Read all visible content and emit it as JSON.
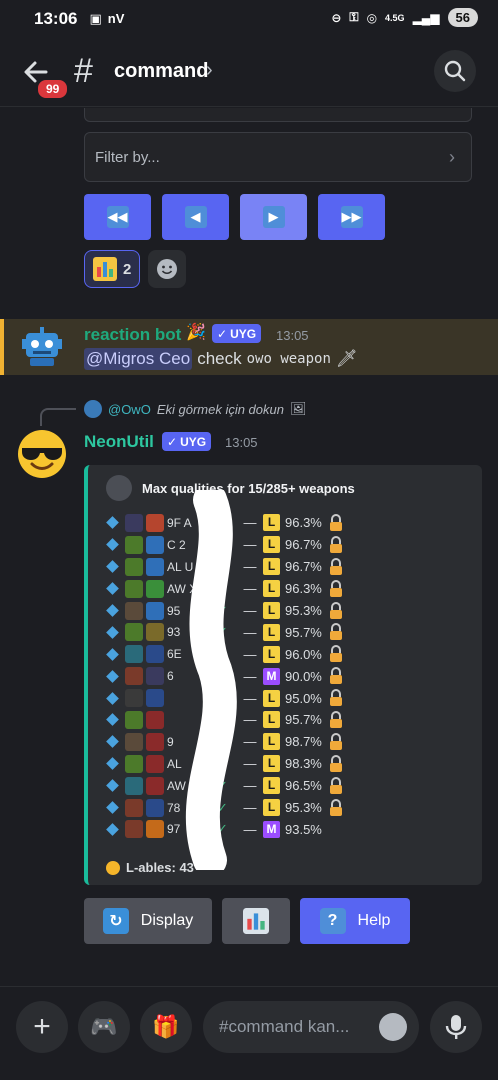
{
  "status": {
    "time": "13:06",
    "left_icons": "nV",
    "network": "4.5G",
    "battery": "56"
  },
  "header": {
    "back_badge": "99",
    "channel": "command"
  },
  "filter": {
    "placeholder": "Filter by..."
  },
  "reactions": {
    "count": "2"
  },
  "message1": {
    "author": "reaction bot",
    "tag": "UYG",
    "time": "13:05",
    "mention": "@Migros Ceo",
    "text": "check",
    "code": "owo weapon"
  },
  "reply": {
    "user": "@OwO",
    "hint": "Eki görmek için dokun"
  },
  "message2": {
    "author": "NeonUtil",
    "tag": "UYG",
    "time": "13:05",
    "embed_title": "Max qualities for 15/285+ weapons",
    "footer": "L-ables: 43",
    "weapons": [
      {
        "name": "9F  A",
        "q": "L",
        "pct": "96.3%",
        "lock": true,
        "c1": "#3a3a5e",
        "c2": "#b5452e"
      },
      {
        "name": "C   2",
        "q": "L",
        "pct": "96.7%",
        "lock": true,
        "c1": "#4c7a2a",
        "c2": "#2f6fb8"
      },
      {
        "name": "AL  U",
        "q": "L",
        "pct": "96.7%",
        "lock": true,
        "c1": "#4c7a2a",
        "c2": "#2f6fb8"
      },
      {
        "name": "AW  X",
        "q": "L",
        "pct": "96.3%",
        "lock": true,
        "c1": "#4c7a2a",
        "c2": "#3a8f3a"
      },
      {
        "name": "95",
        "q": "L",
        "pct": "95.3%",
        "lock": true,
        "c1": "#5a4a3a",
        "c2": "#2f6fb8"
      },
      {
        "name": "93",
        "q": "L",
        "pct": "95.7%",
        "lock": true,
        "c1": "#4c7a2a",
        "c2": "#7a6a2a"
      },
      {
        "name": "6E",
        "q": "L",
        "pct": "96.0%",
        "lock": true,
        "c1": "#2a6a7a",
        "c2": "#2a4a8a"
      },
      {
        "name": "6",
        "q": "M",
        "pct": "90.0%",
        "lock": true,
        "c1": "#7a3a2a",
        "c2": "#3a3a5e"
      },
      {
        "name": "",
        "q": "L",
        "pct": "95.0%",
        "lock": true,
        "c1": "#3a3a3a",
        "c2": "#2a4a8a"
      },
      {
        "name": "",
        "q": "L",
        "pct": "95.7%",
        "lock": true,
        "c1": "#4c7a2a",
        "c2": "#8a2a2a"
      },
      {
        "name": "9",
        "q": "L",
        "pct": "98.7%",
        "lock": true,
        "c1": "#5a4a3a",
        "c2": "#8a2a2a"
      },
      {
        "name": "AL",
        "q": "L",
        "pct": "98.3%",
        "lock": true,
        "c1": "#4c7a2a",
        "c2": "#8a2a2a"
      },
      {
        "name": "AW",
        "q": "L",
        "pct": "96.5%",
        "lock": true,
        "c1": "#2a6a7a",
        "c2": "#8a2a2a"
      },
      {
        "name": "78",
        "q": "L",
        "pct": "95.3%",
        "lock": true,
        "c1": "#7a3a2a",
        "c2": "#2a4a8a"
      },
      {
        "name": "97",
        "q": "M",
        "pct": "93.5%",
        "lock": false,
        "c1": "#7a3a2a",
        "c2": "#c46a1a"
      }
    ]
  },
  "buttons": {
    "display": "Display",
    "help": "Help"
  },
  "composer": {
    "placeholder": "#command kan..."
  }
}
